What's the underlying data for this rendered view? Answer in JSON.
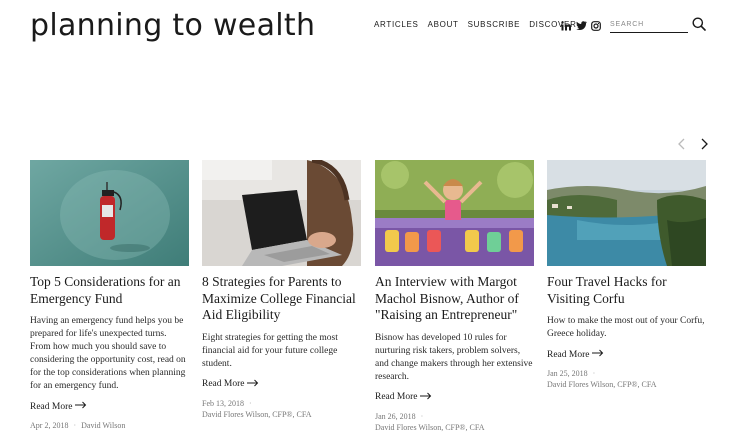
{
  "site": {
    "logo": "planning to wealth"
  },
  "nav": {
    "items": [
      "ARTICLES",
      "ABOUT",
      "SUBSCRIBE",
      "DISCOVER"
    ]
  },
  "social": [
    "linkedin-icon",
    "twitter-icon",
    "instagram-icon"
  ],
  "search": {
    "placeholder": "SEARCH"
  },
  "carousel": {
    "prev": "chevron-left-icon",
    "next": "chevron-right-icon"
  },
  "cards": [
    {
      "title": "Top 5 Considerations for an Emergency Fund",
      "excerpt": "Having an emergency fund helps you be prepared for life's unexpected turns. From how much you should save to considering the opportunity cost, read on for the top considerations when planning for an emergency fund.",
      "more": "Read More",
      "date": "Apr 2, 2018",
      "author": "David Wilson"
    },
    {
      "title": "8 Strategies for Parents to Maximize College Financial Aid Eligibility",
      "excerpt": "Eight strategies for getting the most financial aid for your future college student.",
      "more": "Read More",
      "date": "Feb 13, 2018",
      "author": "David Flores Wilson, CFP®, CFA"
    },
    {
      "title": "An Interview with Margot Machol Bisnow, Author of \"Raising an Entrepreneur\"",
      "excerpt": "Bisnow has developed 10 rules for nurturing risk takers, problem solvers, and change makers through her extensive research.",
      "more": "Read More",
      "date": "Jan 26, 2018",
      "author": "David Flores Wilson, CFP®, CFA"
    },
    {
      "title": "Four Travel Hacks for Visiting Corfu",
      "excerpt": "How to make the most out of your Corfu, Greece holiday.",
      "more": "Read More",
      "date": "Jan 25, 2018",
      "author": "David Flores Wilson, CFP®, CFA"
    }
  ]
}
